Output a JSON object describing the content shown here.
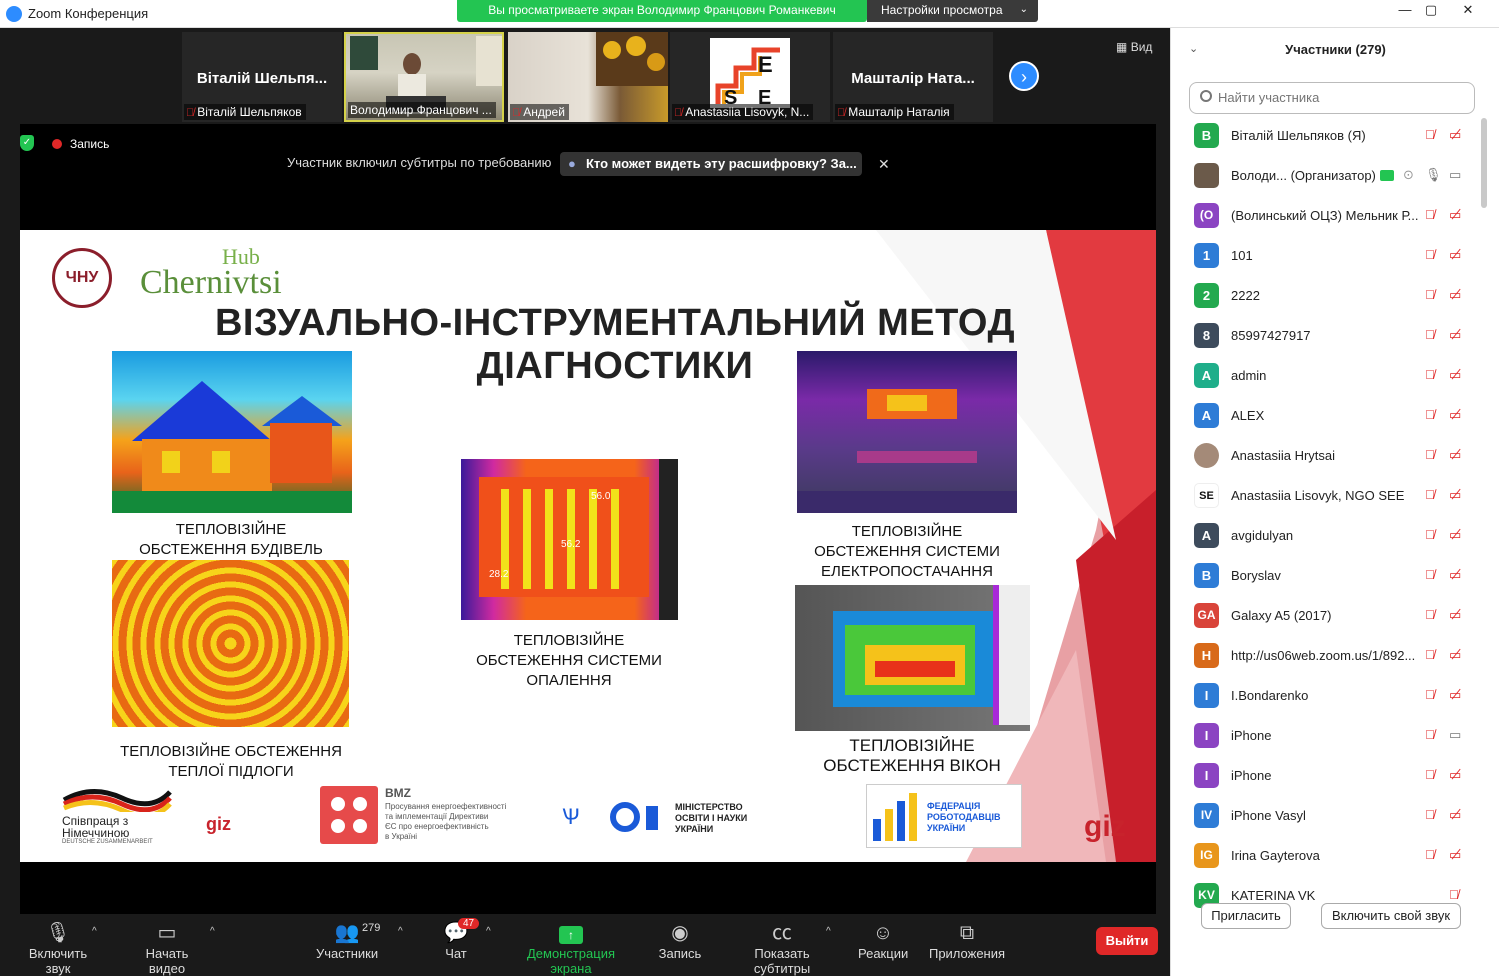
{
  "window": {
    "title": "Zoom Конференция",
    "share_banner": "Вы просматриваете экран Володимир Францович Романкевич",
    "view_settings": "Настройки просмотра",
    "controls": [
      "—",
      "▢",
      "✕"
    ]
  },
  "strip": {
    "view_label": "Вид",
    "tiles": [
      {
        "big_name": "Віталій Шельпя...",
        "label": "Віталій Шельпяков",
        "muted": true
      },
      {
        "big_name": "",
        "label": "Володимир Францович ...",
        "muted": false
      },
      {
        "big_name": "",
        "label": "Андрей",
        "muted": true
      },
      {
        "big_name": "",
        "label": "Anastasiia Lisovyk, N...",
        "muted": true
      },
      {
        "big_name": "Машталір Ната...",
        "label": "Машталір Наталія",
        "muted": true
      }
    ]
  },
  "share": {
    "record_label": "Запись",
    "caption_notice": "Участник включил субтитры по требованию",
    "caption_link": "Кто может видеть эту расшифровку? За..."
  },
  "slide": {
    "title": "ВІЗУАЛЬНО-ІНСТРУМЕНТАЛЬНИЙ МЕТОД ДІАГНОСТИКИ",
    "hub_small": "Hub",
    "hub_big": "Chernivtsi",
    "uni_logo": "ЧНУ",
    "captions": {
      "buildings": "ТЕПЛОВІЗІЙНЕ\nОБСТЕЖЕННЯ БУДІВЕЛЬ",
      "floor": "ТЕПЛОВІЗІЙНЕ ОБСТЕЖЕННЯ\nТЕПЛОЇ ПІДЛОГИ",
      "heating": "ТЕПЛОВІЗІЙНЕ\nОБСТЕЖЕННЯ СИСТЕМИ\nОПАЛЕННЯ",
      "power": "ТЕПЛОВІЗІЙНЕ\nОБСТЕЖЕННЯ СИСТЕМИ\nЕЛЕКТРОПОСТАЧАННЯ",
      "windows": "ТЕПЛОВІЗІЙНЕ\nОБСТЕЖЕННЯ ВІКОН"
    },
    "radiator_labels": [
      "56.0",
      "56.2",
      "28.2"
    ],
    "partners": {
      "cooperation": "Співпраця з\nНімеччиною",
      "cooperation_sub": "DEUTSCHE ZUSAMMENARBEIT",
      "giz_small": "giz",
      "bmz_title": "BMZ",
      "bmz_text": "Просування енергоефективності\nта імплементації Директиви\nЄС про енергоефективність\nв Україні",
      "ministry": "МІНІСТЕРСТВО\nОСВІТИ І НАУКИ\nУКРАЇНИ",
      "federation": "ФЕДЕРАЦІЯ\nРОБОТОДАВЦІВ\nУКРАЇНИ",
      "giz_big": "giz"
    }
  },
  "toolbar": {
    "audio": "Включить звук",
    "video": "Начать видео",
    "participants": "Участники",
    "participants_count": "279",
    "chat": "Чат",
    "chat_badge": "47",
    "share": "Демонстрация экрана",
    "record": "Запись",
    "captions": "Показать субтитры",
    "reactions": "Реакции",
    "apps": "Приложения",
    "leave": "Выйти"
  },
  "panel": {
    "title": "Участники (279)",
    "search_placeholder": "Найти участника",
    "invite": "Пригласить",
    "unmute_self": "Включить свой звук",
    "participants": [
      {
        "initials": "В",
        "color": "#23a94f",
        "name": "Віталій Шельпяков (Я)",
        "cam": "off"
      },
      {
        "initials": "",
        "color": "#6b5a4a",
        "name": "Володи... (Организатор)",
        "cam": "on",
        "host": true
      },
      {
        "initials": "(О",
        "color": "#8b44c2",
        "name": "(Волинський ОЦЗ) Мельник Р...",
        "cam": "off"
      },
      {
        "initials": "1",
        "color": "#2e7cd6",
        "name": "101",
        "cam": "off"
      },
      {
        "initials": "2",
        "color": "#23a94f",
        "name": "2222",
        "cam": "off"
      },
      {
        "initials": "8",
        "color": "#3d4b5c",
        "name": "85997427917",
        "cam": "off"
      },
      {
        "initials": "A",
        "color": "#1fae8a",
        "name": "admin",
        "cam": "off"
      },
      {
        "initials": "A",
        "color": "#2e7cd6",
        "name": "ALEX",
        "cam": "off"
      },
      {
        "initials": "",
        "color": "#a48a78",
        "name": "Anastasiia Hrytsai",
        "cam": "off"
      },
      {
        "initials": "SE",
        "color": "#ffffff",
        "name": "Anastasiia Lisovyk, NGO SEE",
        "cam": "off"
      },
      {
        "initials": "A",
        "color": "#3d4b5c",
        "name": "avgidulyan",
        "cam": "off"
      },
      {
        "initials": "B",
        "color": "#2e7cd6",
        "name": "Boryslav",
        "cam": "off"
      },
      {
        "initials": "GA",
        "color": "#d9443a",
        "name": "Galaxy A5 (2017)",
        "cam": "off"
      },
      {
        "initials": "H",
        "color": "#d86a1a",
        "name": "http://us06web.zoom.us/1/892...",
        "cam": "off"
      },
      {
        "initials": "I",
        "color": "#2e7cd6",
        "name": "I.Bondarenko",
        "cam": "off"
      },
      {
        "initials": "I",
        "color": "#8b44c2",
        "name": "iPhone",
        "cam": "on"
      },
      {
        "initials": "I",
        "color": "#8b44c2",
        "name": "iPhone",
        "cam": "off"
      },
      {
        "initials": "IV",
        "color": "#2e7cd6",
        "name": "iPhone Vasyl",
        "cam": "off"
      },
      {
        "initials": "IG",
        "color": "#e8961c",
        "name": "Irina Gayterova",
        "cam": "off"
      },
      {
        "initials": "KV",
        "color": "#23a94f",
        "name": "KATERINA VK",
        "cam": "none"
      }
    ]
  }
}
